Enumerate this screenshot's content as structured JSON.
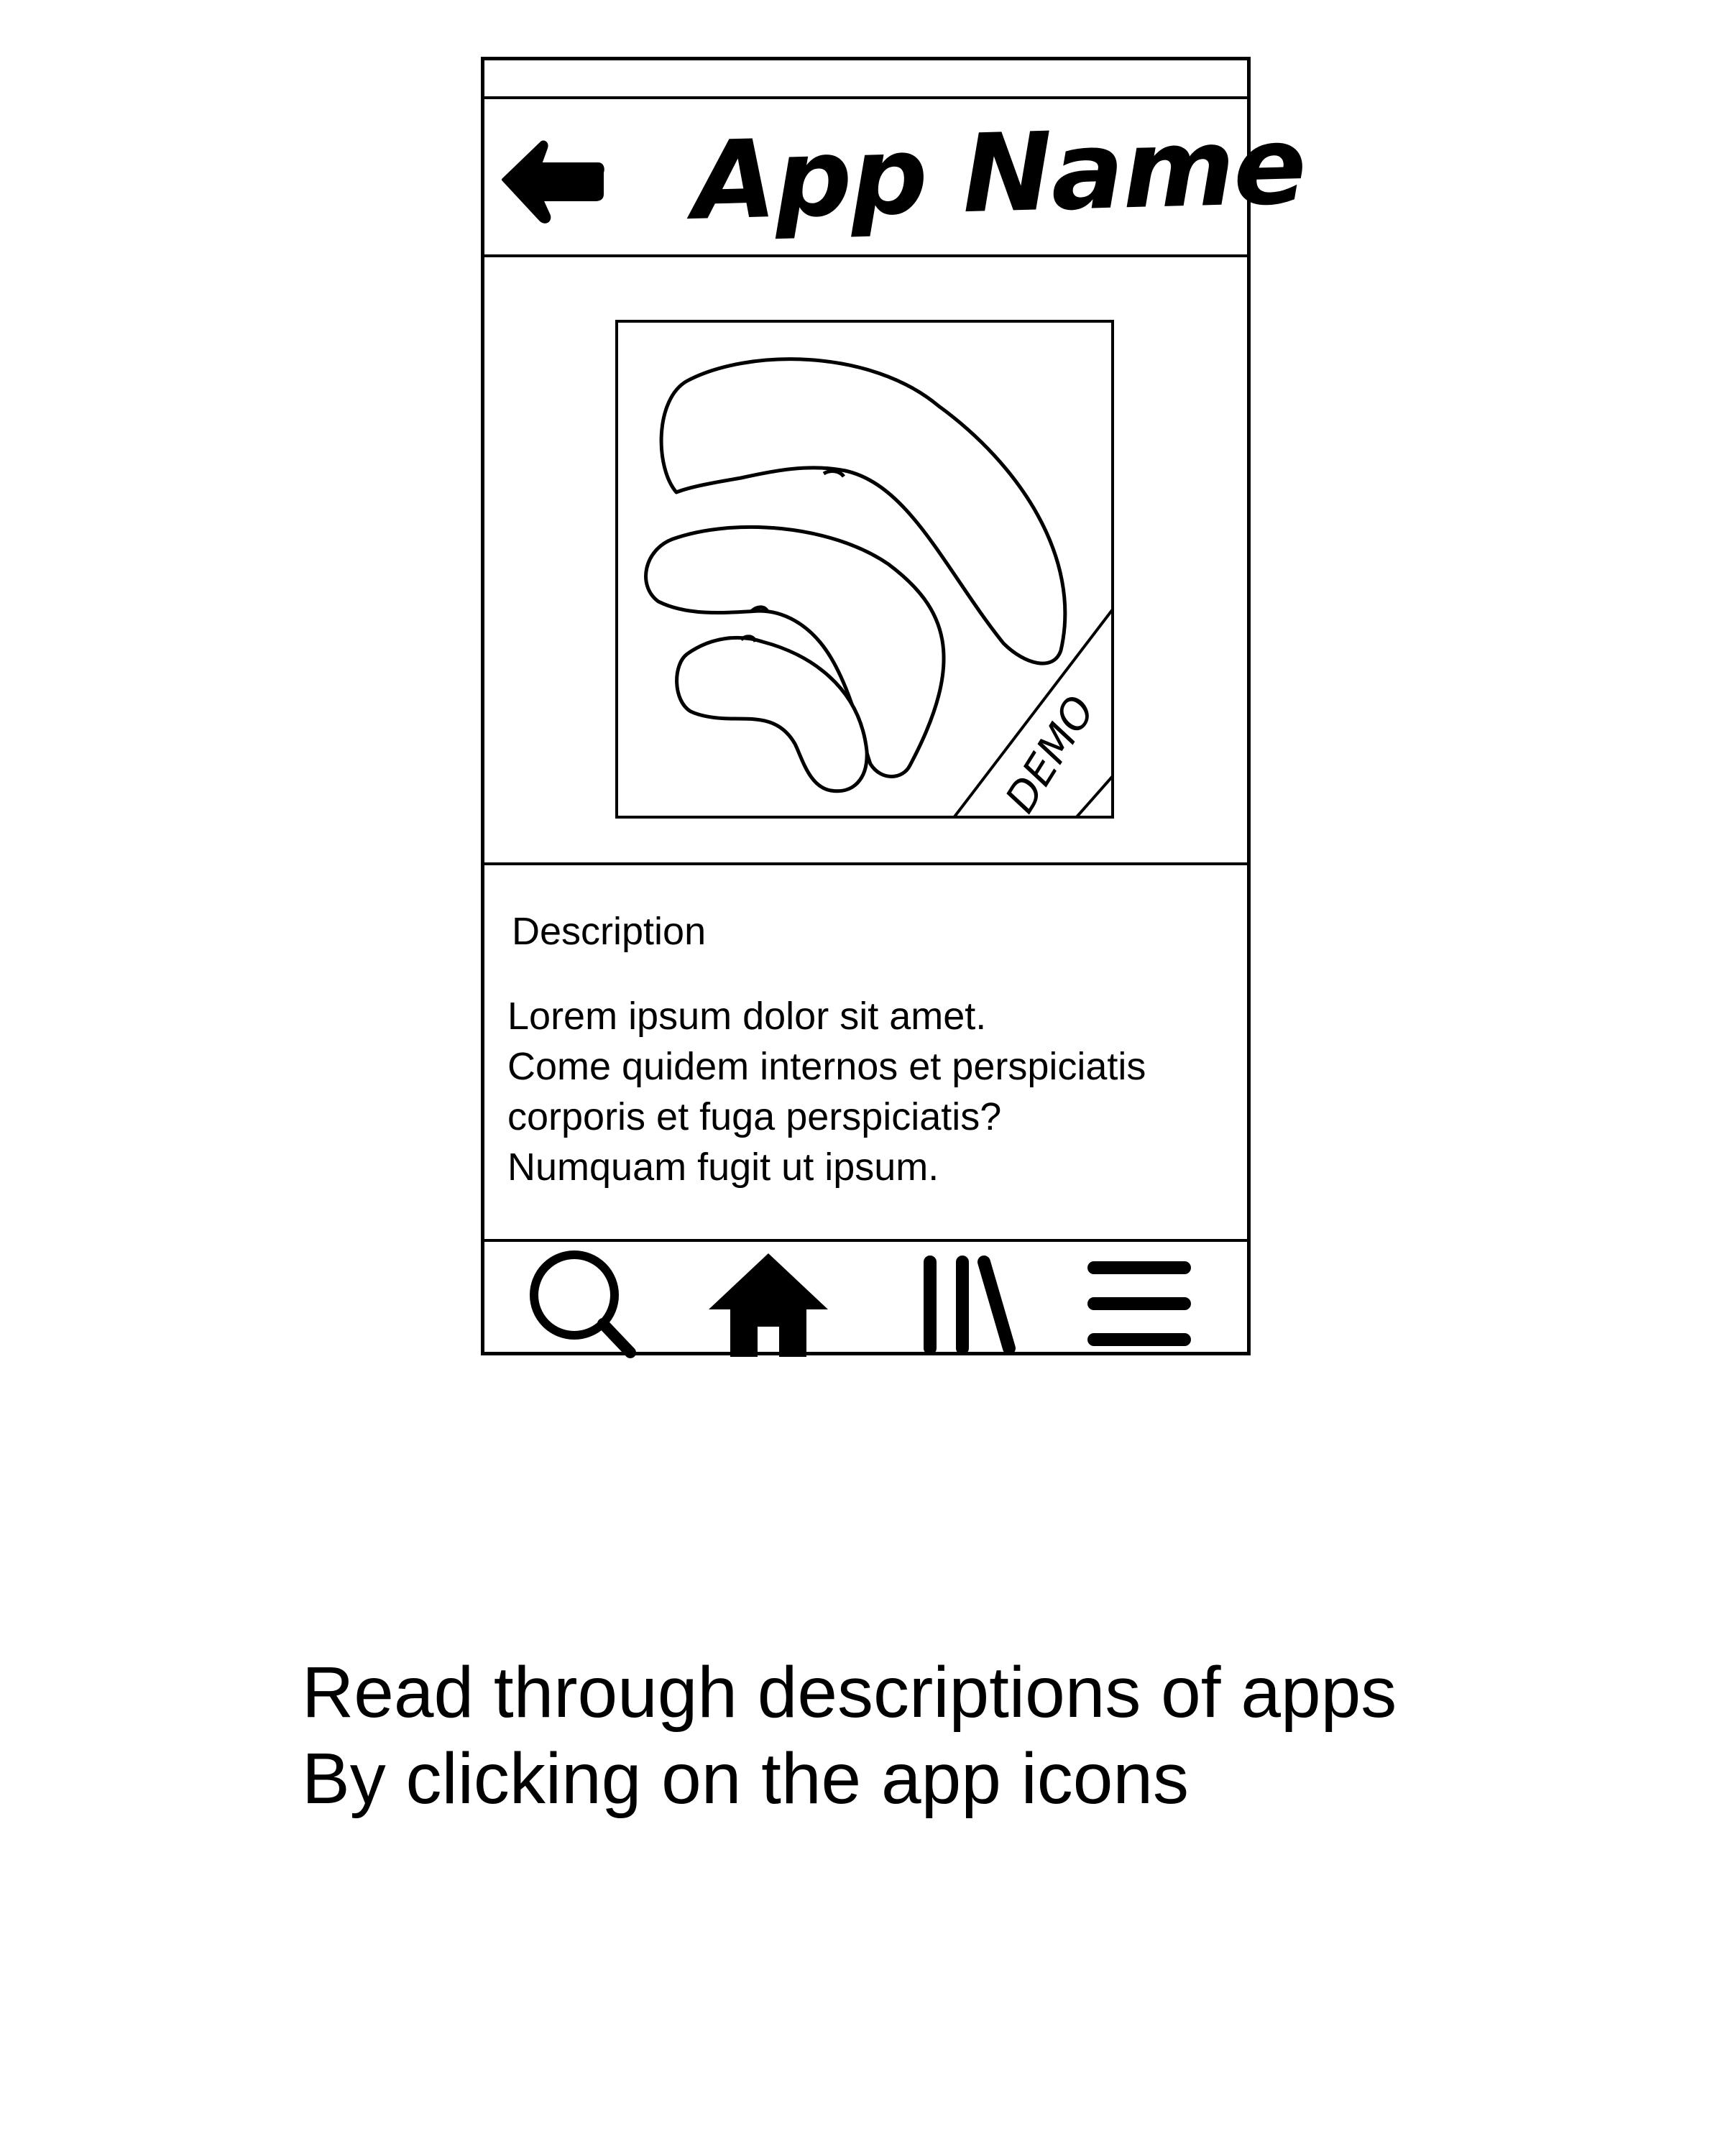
{
  "header": {
    "title": "App Name",
    "back_icon": "arrow-left-icon"
  },
  "app_icon": {
    "icon": "wifi-signal-icon",
    "badge_label": "DEMO"
  },
  "description": {
    "heading": "Description",
    "lines": [
      "Lorem ipsum dolor sit amet.",
      "Come quidem internos et perspiciatis",
      "corporis et fuga perspiciatis?",
      "Numquam fugit ut ipsum."
    ]
  },
  "bottom_nav": {
    "items": [
      {
        "icon": "search-icon"
      },
      {
        "icon": "home-icon"
      },
      {
        "icon": "library-icon"
      },
      {
        "icon": "menu-icon"
      }
    ]
  },
  "caption": {
    "lines": [
      "Read through descriptions of apps",
      "By clicking on the app icons"
    ]
  },
  "colors": {
    "stroke": "#000000",
    "background": "#ffffff"
  }
}
